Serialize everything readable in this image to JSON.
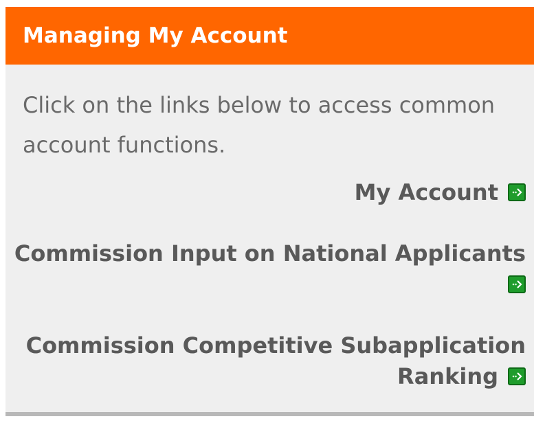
{
  "panel": {
    "title": "Managing My Account",
    "intro": "Click on the links below to access common account functions.",
    "links": [
      {
        "label": "My Account",
        "icon": "green-arrow-icon"
      },
      {
        "label": "Commission Input on National Applicants",
        "icon": "green-arrow-icon"
      },
      {
        "label": "Commission Competitive Subapplication Ranking",
        "icon": "green-arrow-icon"
      }
    ]
  },
  "colors": {
    "header_bg": "#ff6600",
    "header_text": "#ffffff",
    "panel_bg": "#efefef",
    "body_text": "#6a6a6a",
    "link_text": "#595959",
    "icon_green": "#1f9c2c"
  }
}
